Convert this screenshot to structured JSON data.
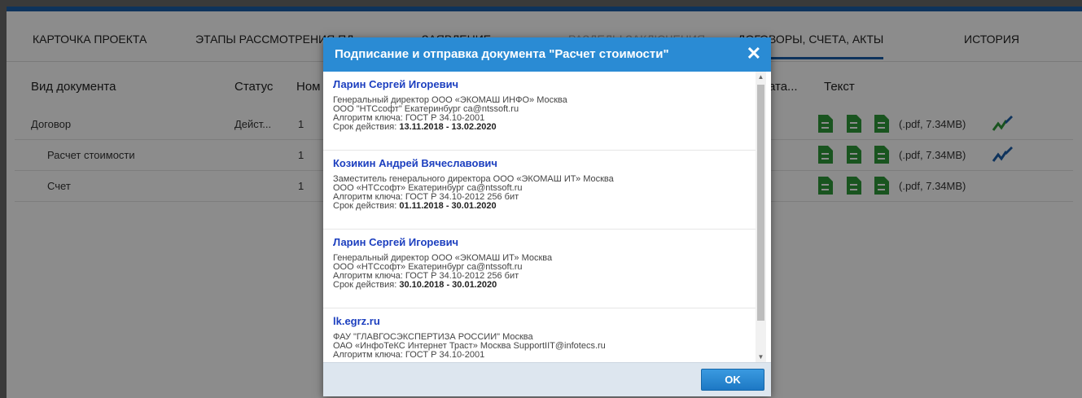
{
  "tabs": [
    {
      "label": "КАРТОЧКА ПРОЕКТА"
    },
    {
      "label": "ЭТАПЫ РАССМОТРЕНИЯ ПД"
    },
    {
      "label": "ЗАЯВЛЕНИЕ"
    },
    {
      "label": "РАЗДЕЛЫ ЗАКЛЮЧЕНИЯ"
    },
    {
      "label": "ДОГОВОРЫ, СЧЕТА, АКТЫ"
    },
    {
      "label": "ИСТОРИЯ"
    }
  ],
  "table": {
    "headers": {
      "doc_type": "Вид документа",
      "status": "Статус",
      "number": "Ном",
      "date": "ата...",
      "text": "Текст"
    },
    "rows": [
      {
        "doc_type": "Договор",
        "status": "Дейст...",
        "number": "1",
        "size": "(.pdf, 7.34MB)"
      },
      {
        "doc_type": "Расчет стоимости",
        "status": "",
        "number": "1",
        "size": "(.pdf, 7.34MB)"
      },
      {
        "doc_type": "Счет",
        "status": "",
        "number": "1",
        "size": "(.pdf, 7.34MB)"
      }
    ]
  },
  "modal": {
    "title": "Подписание и отправка документа \"Расчет стоимости\"",
    "close": "✕",
    "ok_label": "OK",
    "certs": [
      {
        "name": "Ларин Сергей Игоревич",
        "line1": "Генеральный директор ООО «ЭКОМАШ ИНФО» Москва",
        "line2": "ООО \"НТСсофт\" Екатеринбург ca@ntssoft.ru",
        "line3": "Алгоритм ключа: ГОСТ Р 34.10-2001",
        "validity_label": "Срок действия: ",
        "validity": "13.11.2018 - 13.02.2020"
      },
      {
        "name": "Козикин Андрей Вячеславович",
        "line1": "Заместитель генерального директора ООО «ЭКОМАШ ИТ» Москва",
        "line2": "ООО «НТСсофт» Екатеринбург ca@ntssoft.ru",
        "line3": "Алгоритм ключа: ГОСТ Р 34.10-2012 256 бит",
        "validity_label": "Срок действия: ",
        "validity": "01.11.2018 - 30.01.2020"
      },
      {
        "name": "Ларин Сергей Игоревич",
        "line1": "Генеральный директор ООО «ЭКОМАШ ИТ» Москва",
        "line2": "ООО «НТСсофт» Екатеринбург ca@ntssoft.ru",
        "line3": "Алгоритм ключа: ГОСТ Р 34.10-2012 256 бит",
        "validity_label": "Срок действия: ",
        "validity": "30.10.2018 - 30.01.2020"
      },
      {
        "name": "lk.egrz.ru",
        "line1": "ФАУ \"ГЛАВГОСЭКСПЕРТИЗА РОССИИ\" Москва",
        "line2": "ОАО «ИнфоТеКС Интернет Траст» Москва SupportIIT@infotecs.ru",
        "line3": "Алгоритм ключа: ГОСТ Р 34.10-2001",
        "validity_label": "",
        "validity": ""
      }
    ]
  },
  "colors": {
    "header": "#2a8bd4",
    "accent": "#1b5ea8",
    "file_icon": "#2f9a3a",
    "cert_name": "#1c3fbf"
  }
}
